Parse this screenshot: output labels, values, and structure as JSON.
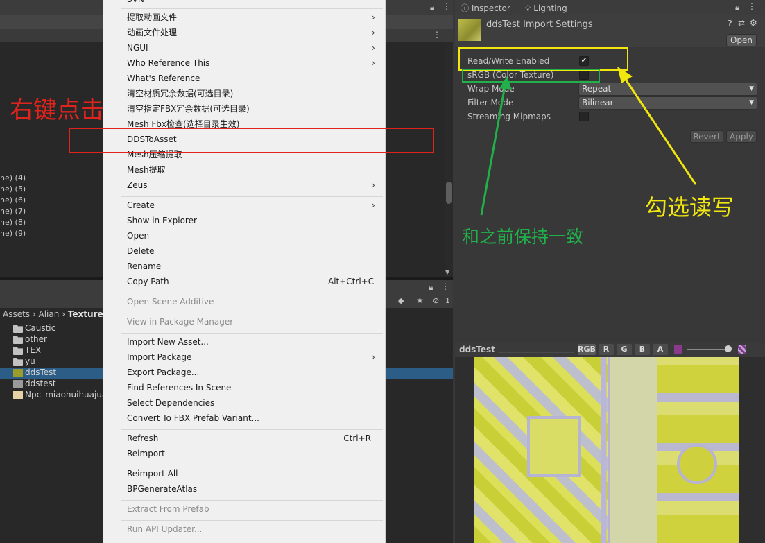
{
  "hierarchy": {
    "items": [
      "ne) (4)",
      "ne) (5)",
      "ne) (6)",
      "ne) (7)",
      "ne) (8)",
      "ne) (9)"
    ]
  },
  "project": {
    "breadcrumb": [
      "Assets",
      "Alian",
      "Texture"
    ],
    "badge_count": "1",
    "files": [
      {
        "name": "Caustic",
        "type": "folder"
      },
      {
        "name": "other",
        "type": "folder"
      },
      {
        "name": "TEX",
        "type": "folder"
      },
      {
        "name": "yu",
        "type": "folder"
      },
      {
        "name": "ddsTest",
        "type": "texture",
        "selected": true
      },
      {
        "name": "ddstest",
        "type": "asset"
      },
      {
        "name": "Npc_miaohuihuajuan",
        "type": "image"
      }
    ]
  },
  "context_menu": {
    "top_partial": "SVN",
    "items": [
      {
        "label": "提取动画文件",
        "submenu": true
      },
      {
        "label": "动画文件处理",
        "submenu": true
      },
      {
        "label": "NGUI",
        "submenu": true
      },
      {
        "label": "Who Reference This",
        "submenu": true
      },
      {
        "label": "What's Reference"
      },
      {
        "label": "清空材质冗余数据(可选目录)"
      },
      {
        "label": "清空指定FBX冗余数据(可选目录)"
      },
      {
        "label": "Mesh Fbx检查(选择目录生效)"
      },
      {
        "label": "DDSToAsset"
      },
      {
        "label": "Mesh压缩提取"
      },
      {
        "label": "Mesh提取"
      },
      {
        "label": "Zeus",
        "submenu": true
      },
      {
        "label": "Create",
        "submenu": true
      },
      {
        "label": "Show in Explorer"
      },
      {
        "label": "Open"
      },
      {
        "label": "Delete"
      },
      {
        "label": "Rename"
      },
      {
        "label": "Copy Path",
        "shortcut": "Alt+Ctrl+C"
      },
      {
        "label": "Open Scene Additive",
        "disabled": true
      },
      {
        "label": "View in Package Manager",
        "disabled": true
      },
      {
        "label": "Import New Asset..."
      },
      {
        "label": "Import Package",
        "submenu": true
      },
      {
        "label": "Export Package..."
      },
      {
        "label": "Find References In Scene"
      },
      {
        "label": "Select Dependencies"
      },
      {
        "label": "Convert To FBX Prefab Variant..."
      },
      {
        "label": "Refresh",
        "shortcut": "Ctrl+R"
      },
      {
        "label": "Reimport"
      },
      {
        "label": "Reimport All"
      },
      {
        "label": "BPGenerateAtlas"
      },
      {
        "label": "Extract From Prefab",
        "disabled": true
      },
      {
        "label": "Run API Updater...",
        "disabled": true
      }
    ]
  },
  "inspector": {
    "tabs": [
      "Inspector",
      "Lighting"
    ],
    "title": "ddsTest Import Settings",
    "open_label": "Open",
    "properties": {
      "read_write": {
        "label": "Read/Write Enabled",
        "checked": true
      },
      "srgb": {
        "label": "sRGB (Color Texture)",
        "checked": false
      },
      "wrap_mode": {
        "label": "Wrap Mode",
        "value": "Repeat"
      },
      "filter_mode": {
        "label": "Filter Mode",
        "value": "Bilinear"
      },
      "streaming_mipmaps": {
        "label": "Streaming Mipmaps",
        "checked": false
      }
    },
    "revert_label": "Revert",
    "apply_label": "Apply"
  },
  "preview": {
    "title": "ddsTest",
    "channels": [
      "RGB",
      "R",
      "G",
      "B",
      "A"
    ]
  },
  "annotations": {
    "right_click": "右键点击",
    "check_read_write": "勾选读写",
    "keep_consistent": "和之前保持一致",
    "red_color": "#e0231c",
    "yellow_color": "#f1e60e",
    "green_color": "#21b04a"
  }
}
